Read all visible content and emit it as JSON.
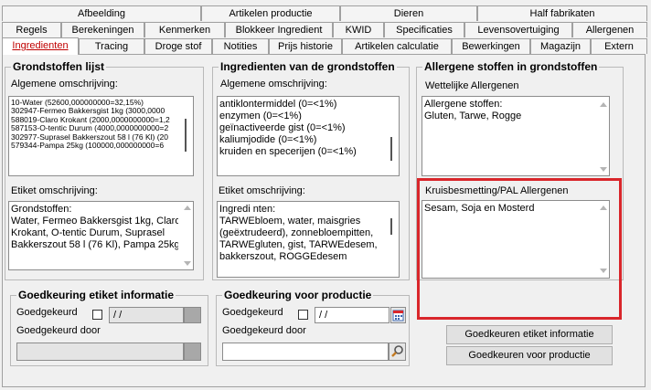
{
  "tabs": {
    "row1": [
      "Afbeelding",
      "Artikelen productie",
      "Dieren",
      "Half fabrikaten"
    ],
    "row2": [
      "Regels",
      "Berekeningen",
      "Kenmerken",
      "Blokkeer Ingredient",
      "KWID",
      "Specificaties",
      "Levensovertuiging",
      "Allergenen"
    ],
    "row3": [
      "Ingredienten",
      "Tracing",
      "Droge stof",
      "Notities",
      "Prijs historie",
      "Artikelen calculatie",
      "Bewerkingen",
      "Magazijn",
      "Extern"
    ]
  },
  "grondstoffen": {
    "title": "Grondstoffen lijst",
    "general_label": "Algemene omschrijving:",
    "items": [
      "10-Water (52600,000000000=32,15%)",
      "302947-Fermeo Bakkersgist 1kg (3000,0000",
      "588019-Claro Krokant (2000,0000000000=1,2",
      "587153-O-tentic Durum (4000,0000000000=2",
      "302977-Suprasel Bakkerszout 58 l (76 Kl) (20",
      "579344-Pampa 25kg (100000,000000000=6"
    ],
    "label_desc": "Etiket omschrijving:",
    "label_lines": [
      "Grondstoffen:",
      "Water, Fermeo Bakkersgist 1kg, Claro",
      "Krokant, O-tentic Durum, Suprasel",
      "Bakkerszout 58 l (76 Kl), Pampa 25kg"
    ]
  },
  "ingredienten": {
    "title": "Ingredienten van de grondstoffen",
    "general_label": "Algemene omschrijving:",
    "items": [
      "antiklontermiddel (0=<1%)",
      "enzymen (0=<1%)",
      "geïnactiveerde gist (0=<1%)",
      "kaliumjodide (0=<1%)",
      "kruiden en specerijen (0=<1%)"
    ],
    "label_desc": "Etiket omschrijving:",
    "label_lines": [
      "Ingredi nten:",
      "TARWEbloem, water, maisgries",
      "(geëxtrudeerd), zonnebloempitten,",
      "TARWEgluten, gist, TARWEdesem,",
      "bakkerszout, ROGGEdesem"
    ]
  },
  "allergenen": {
    "title": "Allergene stoffen in grondstoffen",
    "wettelijke_label": "Wettelijke Allergenen",
    "lines": [
      "Allergene stoffen:",
      "Gluten, Tarwe, Rogge"
    ],
    "kruis_label": "Kruisbesmetting/PAL Allergenen",
    "kruis_value": "Sesam, Soja en Mosterd"
  },
  "goedkeuring_etiket": {
    "title": "Goedkeuring etiket informatie",
    "approved_label": "Goedgekeurd",
    "date_value": " / /",
    "by_label": "Goedgekeurd door"
  },
  "goedkeuring_productie": {
    "title": "Goedkeuring voor productie",
    "approved_label": "Goedgekeurd",
    "date_value": " / /",
    "by_label": "Goedgekeurd door"
  },
  "buttons": {
    "approve_label_info": "Goedkeuren etiket informatie",
    "approve_production": "Goedkeuren voor productie"
  },
  "colors": {
    "highlight": "#d9262b",
    "active_tab_text": "#c00000"
  },
  "icons": [
    "calendar-icon",
    "search-icon",
    "scroll-up-arrow",
    "scroll-down-arrow"
  ]
}
